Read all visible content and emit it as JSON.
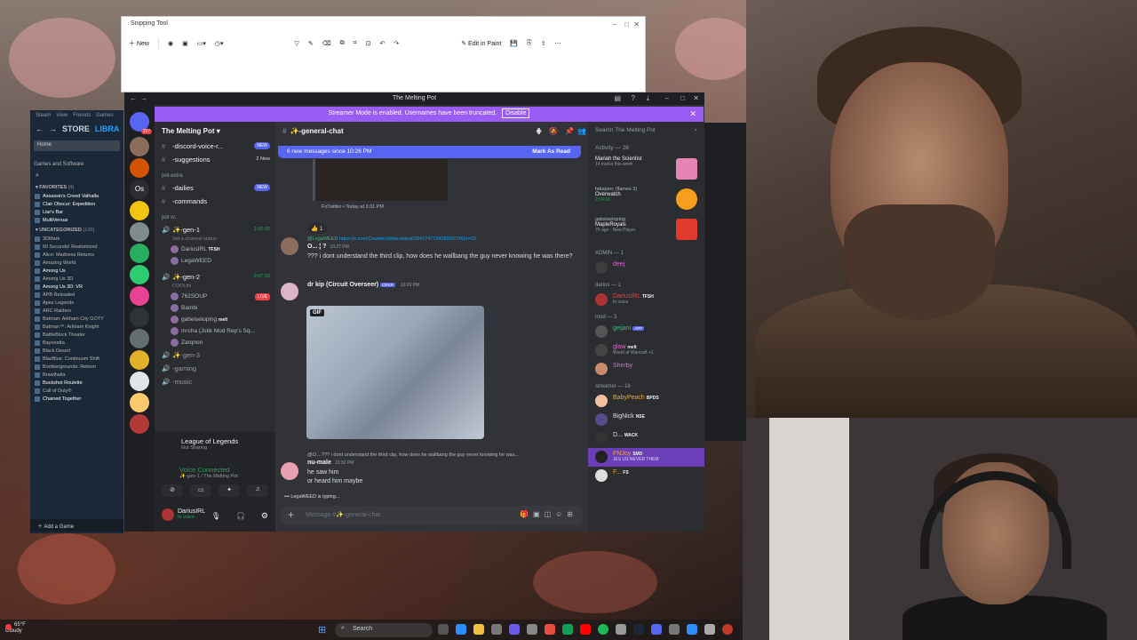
{
  "snipping_tool": {
    "title": "Snipping Tool",
    "new_label": "New",
    "edit_in_paint": "Edit in Paint"
  },
  "steam": {
    "menu": [
      "Steam",
      "View",
      "Friends",
      "Games"
    ],
    "store": "STORE",
    "library": "LIBRA",
    "home": "Home",
    "games_software": "Games and Software",
    "favorites_header": "FAVORITES",
    "favorites_count": "(4)",
    "favorites": [
      "Assassin's Creed Valhalla",
      "Clair Obscur: Expedition",
      "Liar's Bar",
      "MultiVersus"
    ],
    "uncategorized_header": "UNCATEGORIZED",
    "uncategorized_count": "(135)",
    "uncategorized": [
      "3DMark",
      "60 Seconds! Reatomized",
      "Alice: Madness Returns",
      "Amazing World",
      "Among Us",
      "Among Us 3D",
      "Among Us 3D: VR",
      "APB Reloaded",
      "Apex Legends",
      "ARC Raiders",
      "Batman: Arkham City GOTY",
      "Batman™: Arkham Knight",
      "BattleBlock Theater",
      "Bayonetta",
      "Black Desert",
      "BlazBlue: Continuum Shift",
      "Bombergrounds: Reborn",
      "Brawlhalla",
      "Buckshot Roulette",
      "Call of Duty®",
      "Chained Together"
    ],
    "add_game": "Add a Game"
  },
  "discord": {
    "window_title": "The Melting Pot",
    "banner_text": "Streamer Mode is enabled. Usernames have been truncated.",
    "banner_disable": "Disable",
    "server_name": "The Melting Pot",
    "channel_header": "✨-general-chat",
    "channels_top": [
      {
        "name": "-discord-voice-r...",
        "tag": "NEW"
      },
      {
        "name": "-suggestions",
        "tag": "2 New"
      }
    ],
    "cat_pot_extra": "pot-extra",
    "channels_extra": [
      {
        "name": "-dailies",
        "tag": "NEW"
      },
      {
        "name": "-commands",
        "tag": ""
      }
    ],
    "cat_pot_vc": "pot vc",
    "vc1": {
      "name": "✨-gen-1",
      "time": "1:00:32",
      "status": "Set a channel status"
    },
    "vc1_users": [
      "DariusIRL",
      "LegaWEED"
    ],
    "vc1_user_badge": "TFSH",
    "vc2": {
      "name": "✨-gen-2",
      "time": "9:07:33",
      "status": "COOLIN"
    },
    "vc2_users": [
      "762SOUP",
      "Bambi",
      "gabeiseloping",
      "mrcha (Jstik Mod Rep's Sq...",
      "Zarqnon"
    ],
    "live_label": "LIVE",
    "melt_label": "melt",
    "vc_more": [
      "✨-gen-3",
      "-gaming",
      "-music"
    ],
    "activity_game": "League of Legends",
    "activity_status": "Not Sharing",
    "voice_connected": "Voice Connected",
    "voice_channel": "✨-gen-1 / The Melting Pot",
    "user_name": "DariusIRL",
    "user_status": "In voice",
    "new_messages": "6 new messages since 10:26 PM",
    "mark_as_read": "Mark As Read",
    "embed_footer": "FxTwitter • Today at 3:31 PM",
    "reaction_count": "1",
    "msg1": {
      "reply_user": "@LegaWEED",
      "reply_link": "https://x.com/CounterStrike/status/2047747134382697041s=20",
      "author": "O... ¦ ?",
      "time": "10:27 PM",
      "text": "??? i dont understand the third clip, how does he wallbang the guy never knowing he was there?"
    },
    "msg2": {
      "author": "dr kip (Circuit Overseer)",
      "tag": "CRKR",
      "time": "10:29 PM",
      "gif": "GIF"
    },
    "msg3": {
      "reply": "@O... ??? i dont understand the third clip, how does he wallbang the guy never knowing he was...",
      "author": "nu-male",
      "time": "10:30 PM",
      "lines": [
        "he saw him",
        "or heard him maybe"
      ]
    },
    "typing": "LegaWEED is typing...",
    "input_placeholder": "Message #✨-general-chat",
    "search_placeholder": "Search The Melting Pot",
    "activity_header": "Activity — 28",
    "activities": [
      {
        "user": "",
        "title": "Mariah the Scientist",
        "meta": "14 tracks this week",
        "color": "#e685b5"
      },
      {
        "user": "fakeperc (flames 3)",
        "title": "Overwatch",
        "meta": "2:04:16",
        "color": "#f99e1a"
      },
      {
        "user": "gabeiseloping",
        "title": "MapleRoyals",
        "meta": "7h ago · New Player",
        "color": "#e23b2e"
      }
    ],
    "roles": [
      {
        "header": "ADMIN — 1",
        "members": [
          {
            "name": "deej",
            "color": "#e06bd3",
            "badge": "",
            "status": ""
          }
        ]
      },
      {
        "header": "darius — 1",
        "members": [
          {
            "name": "DariusIRL",
            "color": "#f23f43",
            "badge": "TFSH",
            "status": "In voice"
          }
        ]
      },
      {
        "header": "mod — 3",
        "members": [
          {
            "name": "geijani",
            "color": "#43b581",
            "badge": "APP",
            "status": ""
          },
          {
            "name": "glow",
            "color": "#e06bd3",
            "badge": "melt",
            "status": "World of Warcraft +1"
          },
          {
            "name": "Sherby",
            "color": "#e06bd3",
            "badge": "",
            "status": ""
          }
        ]
      },
      {
        "header": "streamer — 16",
        "members": [
          {
            "name": "BabyPeach",
            "color": "#faa61a",
            "badge": "BPDS",
            "status": ""
          },
          {
            "name": "BigNick",
            "color": "#e0e0e0",
            "badge": "NSE",
            "status": ""
          },
          {
            "name": "D...",
            "color": "#e0e0e0",
            "badge": "WACK",
            "status": ""
          },
          {
            "name": "FNJoy",
            "color": "#faa61a",
            "badge": "SMD",
            "status": "JES US NEVER THEM"
          },
          {
            "name": "F...",
            "color": "#faa61a",
            "badge": "FS",
            "status": ""
          }
        ]
      }
    ]
  },
  "taskbar": {
    "temp": "65°F",
    "weather": "Cloudy",
    "search": "Search"
  },
  "colors": {
    "discord_bg": "#313338",
    "banner": "#9b5cf4",
    "blurple": "#5865f2",
    "online": "#23a55a",
    "steam_bg": "#1b2838"
  }
}
